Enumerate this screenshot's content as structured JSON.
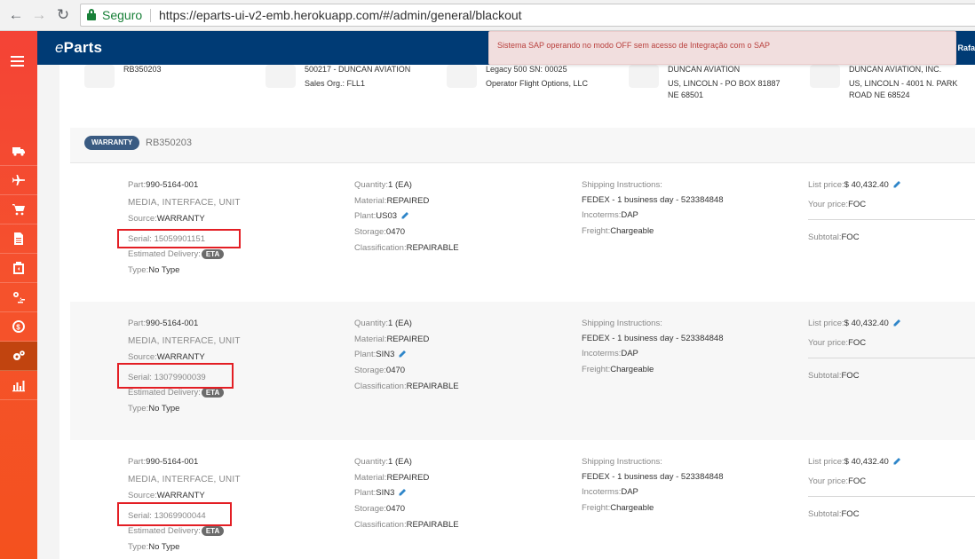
{
  "browser": {
    "secure_label": "Seguro",
    "url": "https://eparts-ui-v2-emb.herokuapp.com/#/admin/general/blackout"
  },
  "header": {
    "logo_prefix": "e",
    "logo_rest": "Parts",
    "user_name": "Rafa",
    "alert": "Sistema SAP operando no modo OFF sem acesso de Integração com o SAP"
  },
  "sidebar": {
    "items": [
      "truck-icon",
      "plane-icon",
      "cart-icon",
      "document-icon",
      "package-icon",
      "exchange-icon",
      "money-icon",
      "gears-icon",
      "bar-chart-icon"
    ],
    "active_index": 7
  },
  "summary": {
    "col1": {
      "l1": "RB350203"
    },
    "col2": {
      "l1": "500217 - DUNCAN AVIATION",
      "l2": "Sales Org.: FLL1"
    },
    "col3": {
      "l1": "Legacy 500 SN: 00025",
      "l2": "Operator Flight Options, LLC"
    },
    "col4": {
      "l1": "DUNCAN AVIATION",
      "l2": "US, LINCOLN - PO BOX 81887",
      "l3": "NE 68501"
    },
    "col5": {
      "l1": "DUNCAN AVIATION, INC.",
      "l2": "US, LINCOLN - 4001 N. PARK",
      "l3": "ROAD NE 68524"
    }
  },
  "order": {
    "badge": "WARRANTY",
    "number": "RB350203"
  },
  "labels": {
    "part": "Part:",
    "source": "Source:",
    "serial": "Serial: ",
    "estimated_delivery": "Estimated Delivery:",
    "eta": "ETA",
    "type": "Type:",
    "quantity": "Quantity:",
    "material": "Material:",
    "plant": "Plant:",
    "storage": "Storage:",
    "classification": "Classification:",
    "shipping_instructions": "Shipping Instructions:",
    "incoterms": "Incoterms:",
    "freight": "Freight:",
    "list_price": "List price:",
    "your_price": "Your price:",
    "subtotal": "Subtotal:"
  },
  "items": [
    {
      "part": "990-5164-001",
      "description": "MEDIA, INTERFACE, UNIT",
      "source": "WARRANTY",
      "serial": "15059901151",
      "type": "No Type",
      "quantity": "1 (EA)",
      "material": "REPAIRED",
      "plant": "US03",
      "storage": "0470",
      "classification": "REPAIRABLE",
      "shipping": "FEDEX - 1 business day - 523384848",
      "incoterms": "DAP",
      "freight": "Chargeable",
      "list_price": "$ 40,432.40",
      "your_price": "FOC",
      "subtotal": "FOC"
    },
    {
      "part": "990-5164-001",
      "description": "MEDIA, INTERFACE, UNIT",
      "source": "WARRANTY",
      "serial": "13079900039",
      "type": "No Type",
      "quantity": "1 (EA)",
      "material": "REPAIRED",
      "plant": "SIN3",
      "storage": "0470",
      "classification": "REPAIRABLE",
      "shipping": "FEDEX - 1 business day - 523384848",
      "incoterms": "DAP",
      "freight": "Chargeable",
      "list_price": "$ 40,432.40",
      "your_price": "FOC",
      "subtotal": "FOC"
    },
    {
      "part": "990-5164-001",
      "description": "MEDIA, INTERFACE, UNIT",
      "source": "WARRANTY",
      "serial": "13069900044",
      "type": "No Type",
      "quantity": "1 (EA)",
      "material": "REPAIRED",
      "plant": "SIN3",
      "storage": "0470",
      "classification": "REPAIRABLE",
      "shipping": "FEDEX - 1 business day - 523384848",
      "incoterms": "DAP",
      "freight": "Chargeable",
      "list_price": "$ 40,432.40",
      "your_price": "FOC",
      "subtotal": "FOC"
    }
  ],
  "colors": {
    "sidebar": "#f4511e",
    "topbar": "#003b75",
    "badge": "#3a5b82",
    "highlight": "#e31e24",
    "alert_text": "#b9403d"
  }
}
